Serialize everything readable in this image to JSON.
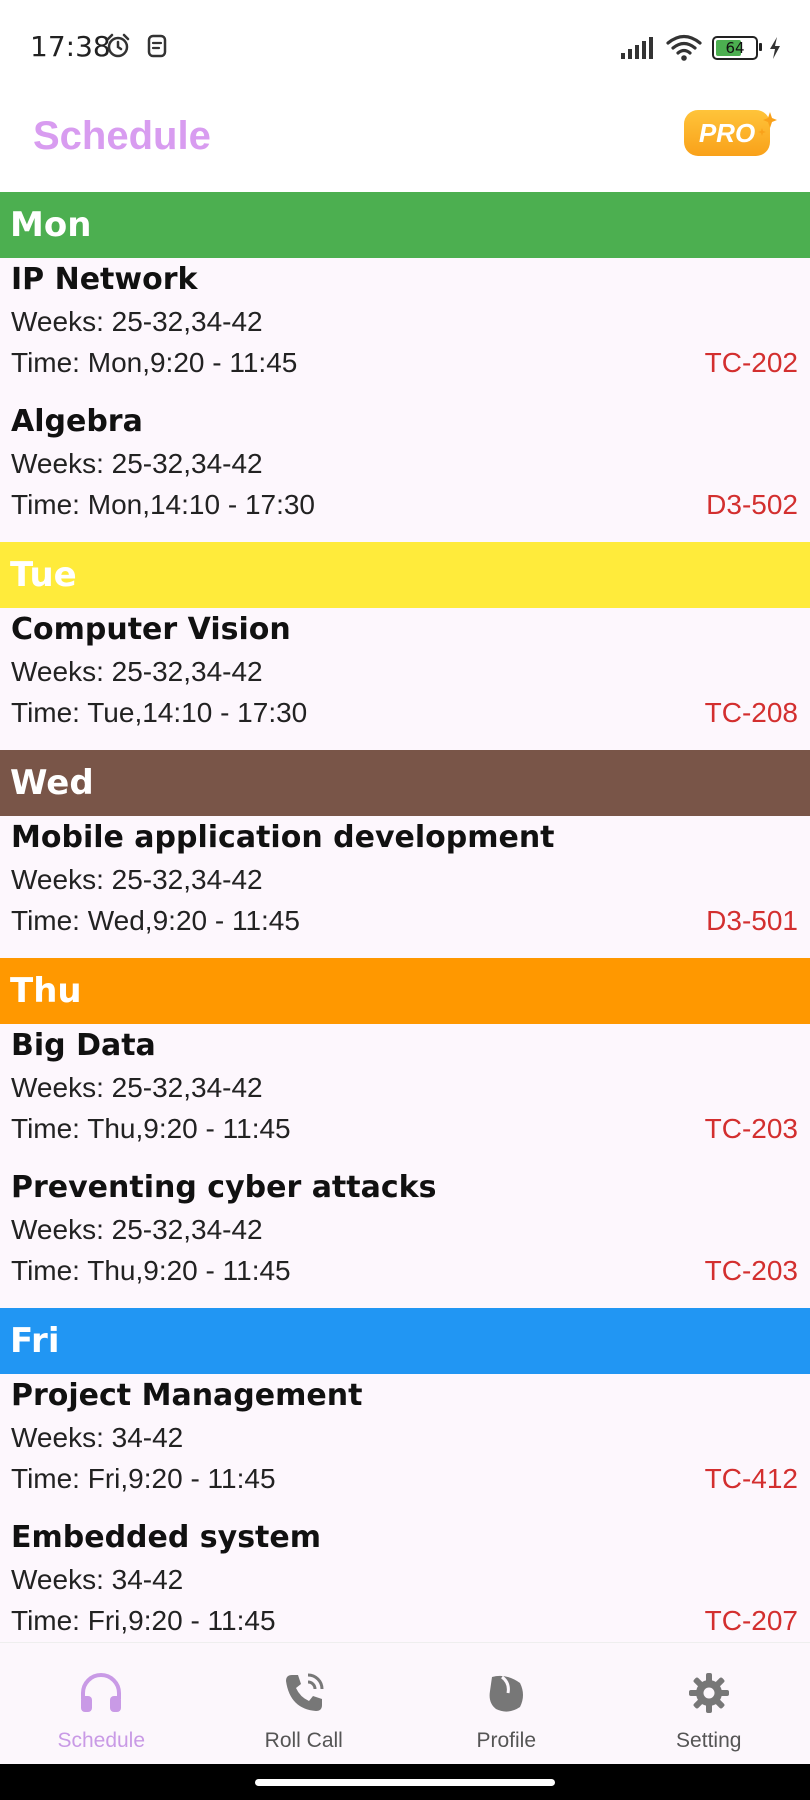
{
  "status_bar": {
    "time": "17:38",
    "battery": "64"
  },
  "header": {
    "title": "Schedule",
    "pro_label": "PRO"
  },
  "colors": {
    "mon": "#4caf50",
    "tue": "#ffeb3b",
    "wed": "#795548",
    "thu": "#ff9800",
    "fri": "#2196f3",
    "accent": "#d89cf0",
    "room": "#d32f2f"
  },
  "days": [
    {
      "label": "Mon",
      "courses": [
        {
          "name": "IP Network",
          "weeks": "Weeks: 25-32,34-42",
          "time": "Time: Mon,9:20 - 11:45",
          "room": "TC-202"
        },
        {
          "name": "Algebra",
          "weeks": "Weeks: 25-32,34-42",
          "time": "Time: Mon,14:10 - 17:30",
          "room": "D3-502"
        }
      ]
    },
    {
      "label": "Tue",
      "courses": [
        {
          "name": "Computer Vision",
          "weeks": "Weeks: 25-32,34-42",
          "time": "Time: Tue,14:10 - 17:30",
          "room": "TC-208"
        }
      ]
    },
    {
      "label": "Wed",
      "courses": [
        {
          "name": "Mobile application development",
          "weeks": "Weeks: 25-32,34-42",
          "time": "Time: Wed,9:20 - 11:45",
          "room": "D3-501"
        }
      ]
    },
    {
      "label": "Thu",
      "courses": [
        {
          "name": "Big Data",
          "weeks": "Weeks: 25-32,34-42",
          "time": "Time: Thu,9:20 - 11:45",
          "room": "TC-203"
        },
        {
          "name": "Preventing cyber attacks",
          "weeks": "Weeks: 25-32,34-42",
          "time": "Time: Thu,9:20 - 11:45",
          "room": "TC-203"
        }
      ]
    },
    {
      "label": "Fri",
      "courses": [
        {
          "name": "Project Management",
          "weeks": "Weeks: 34-42",
          "time": "Time: Fri,9:20 - 11:45",
          "room": "TC-412"
        },
        {
          "name": "Embedded system",
          "weeks": "Weeks: 34-42",
          "time": "Time: Fri,9:20 - 11:45",
          "room": "TC-207"
        }
      ]
    }
  ],
  "bottom_nav": [
    {
      "label": "Schedule",
      "icon": "headphones-icon",
      "active": true
    },
    {
      "label": "Roll Call",
      "icon": "phone-icon",
      "active": false
    },
    {
      "label": "Profile",
      "icon": "profile-icon",
      "active": false
    },
    {
      "label": "Setting",
      "icon": "gear-icon",
      "active": false
    }
  ]
}
